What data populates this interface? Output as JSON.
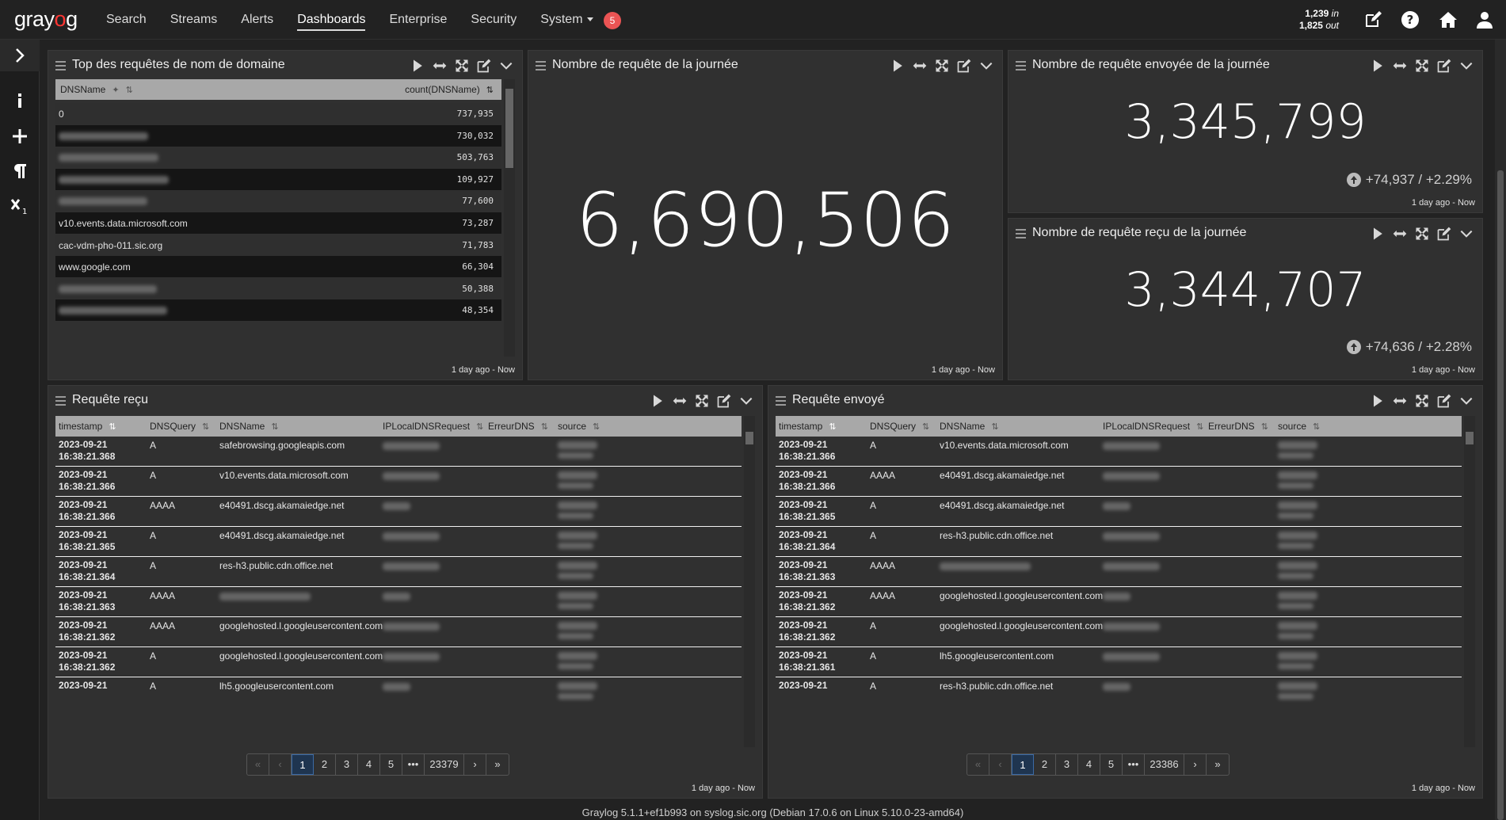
{
  "app": {
    "logo_pre": "gray",
    "logo_o": "o",
    "logo_post": "g"
  },
  "nav": {
    "items": [
      "Search",
      "Streams",
      "Alerts",
      "Dashboards",
      "Enterprise",
      "Security",
      "System"
    ],
    "active": "Dashboards",
    "notifications": "5",
    "throughput_in": "1,239",
    "throughput_in_label": "in",
    "throughput_out": "1,825",
    "throughput_out_label": "out"
  },
  "sidebar": {
    "icons": [
      "chevron-right-icon",
      "info-icon",
      "plus-icon",
      "paragraph-icon",
      "subscript-icon"
    ]
  },
  "widgets": {
    "top_domains": {
      "title": "Top des requêtes de nom de domaine",
      "col_name": "DNSName",
      "col_count": "count(DNSName)",
      "rows": [
        {
          "name": "0",
          "count": "737,935",
          "hidden": false
        },
        {
          "name": "",
          "count": "730,032",
          "hidden": true
        },
        {
          "name": "",
          "count": "503,763",
          "hidden": true
        },
        {
          "name": "",
          "count": "109,927",
          "hidden": true
        },
        {
          "name": "",
          "count": "77,600",
          "hidden": true
        },
        {
          "name": "v10.events.data.microsoft.com",
          "count": "73,287",
          "hidden": false
        },
        {
          "name": "cac-vdm-pho-011.sic.org",
          "count": "71,783",
          "hidden": false
        },
        {
          "name": "www.google.com",
          "count": "66,304",
          "hidden": false
        },
        {
          "name": "",
          "count": "50,388",
          "hidden": true
        },
        {
          "name": "",
          "count": "48,354",
          "hidden": true
        }
      ],
      "timerange": "1 day ago - Now"
    },
    "total_day": {
      "title": "Nombre de requête de la journée",
      "value": "6,690,506",
      "timerange": "1 day ago - Now"
    },
    "sent_day": {
      "title": "Nombre de requête envoyée de la journée",
      "value": "3,345,799",
      "delta": "+74,937 / +2.29%",
      "timerange": "1 day ago - Now"
    },
    "recv_day": {
      "title": "Nombre de requête reçu de la journée",
      "value": "3,344,707",
      "delta": "+74,636 / +2.28%",
      "timerange": "1 day ago - Now"
    },
    "recv_table": {
      "title": "Requête reçu",
      "columns": [
        "timestamp",
        "DNSQuery",
        "DNSName",
        "IPLocalDNSRequest",
        "ErreurDNS",
        "source"
      ],
      "rows": [
        {
          "date": "2023-09-21",
          "time": "16:38:21.368",
          "query": "A",
          "name": "safebrowsing.googleapis.com"
        },
        {
          "date": "2023-09-21",
          "time": "16:38:21.366",
          "query": "A",
          "name": "v10.events.data.microsoft.com"
        },
        {
          "date": "2023-09-21",
          "time": "16:38:21.366",
          "query": "AAAA",
          "name": "e40491.dscg.akamaiedge.net"
        },
        {
          "date": "2023-09-21",
          "time": "16:38:21.365",
          "query": "A",
          "name": "e40491.dscg.akamaiedge.net"
        },
        {
          "date": "2023-09-21",
          "time": "16:38:21.364",
          "query": "A",
          "name": "res-h3.public.cdn.office.net"
        },
        {
          "date": "2023-09-21",
          "time": "16:38:21.363",
          "query": "AAAA",
          "name": ""
        },
        {
          "date": "2023-09-21",
          "time": "16:38:21.362",
          "query": "AAAA",
          "name": "googlehosted.l.googleusercontent.com"
        },
        {
          "date": "2023-09-21",
          "time": "16:38:21.362",
          "query": "A",
          "name": "googlehosted.l.googleusercontent.com"
        },
        {
          "date": "2023-09-21",
          "time": "",
          "query": "A",
          "name": "lh5.googleusercontent.com"
        }
      ],
      "pages": [
        "1",
        "2",
        "3",
        "4",
        "5",
        "•••",
        "23379"
      ],
      "timerange": "1 day ago - Now"
    },
    "sent_table": {
      "title": "Requête envoyé",
      "columns": [
        "timestamp",
        "DNSQuery",
        "DNSName",
        "IPLocalDNSRequest",
        "ErreurDNS",
        "source"
      ],
      "rows": [
        {
          "date": "2023-09-21",
          "time": "16:38:21.366",
          "query": "A",
          "name": "v10.events.data.microsoft.com"
        },
        {
          "date": "2023-09-21",
          "time": "16:38:21.366",
          "query": "AAAA",
          "name": "e40491.dscg.akamaiedge.net"
        },
        {
          "date": "2023-09-21",
          "time": "16:38:21.365",
          "query": "A",
          "name": "e40491.dscg.akamaiedge.net"
        },
        {
          "date": "2023-09-21",
          "time": "16:38:21.364",
          "query": "A",
          "name": "res-h3.public.cdn.office.net"
        },
        {
          "date": "2023-09-21",
          "time": "16:38:21.363",
          "query": "AAAA",
          "name": ""
        },
        {
          "date": "2023-09-21",
          "time": "16:38:21.362",
          "query": "AAAA",
          "name": "googlehosted.l.googleusercontent.com"
        },
        {
          "date": "2023-09-21",
          "time": "16:38:21.362",
          "query": "A",
          "name": "googlehosted.l.googleusercontent.com"
        },
        {
          "date": "2023-09-21",
          "time": "16:38:21.361",
          "query": "A",
          "name": "lh5.googleusercontent.com"
        },
        {
          "date": "2023-09-21",
          "time": "",
          "query": "A",
          "name": "res-h3.public.cdn.office.net"
        }
      ],
      "pages": [
        "1",
        "2",
        "3",
        "4",
        "5",
        "•••",
        "23386"
      ],
      "timerange": "1 day ago - Now"
    }
  },
  "footer": "Graylog 5.1.1+ef1b993 on syslog.sic.org (Debian 17.0.6 on Linux 5.10.0-23-amd64)",
  "colors": {
    "background": "#222222",
    "widget": "#303030",
    "accent_red": "#ff3633",
    "badge": "#eb5454",
    "table_header": "#a8a8a8"
  }
}
